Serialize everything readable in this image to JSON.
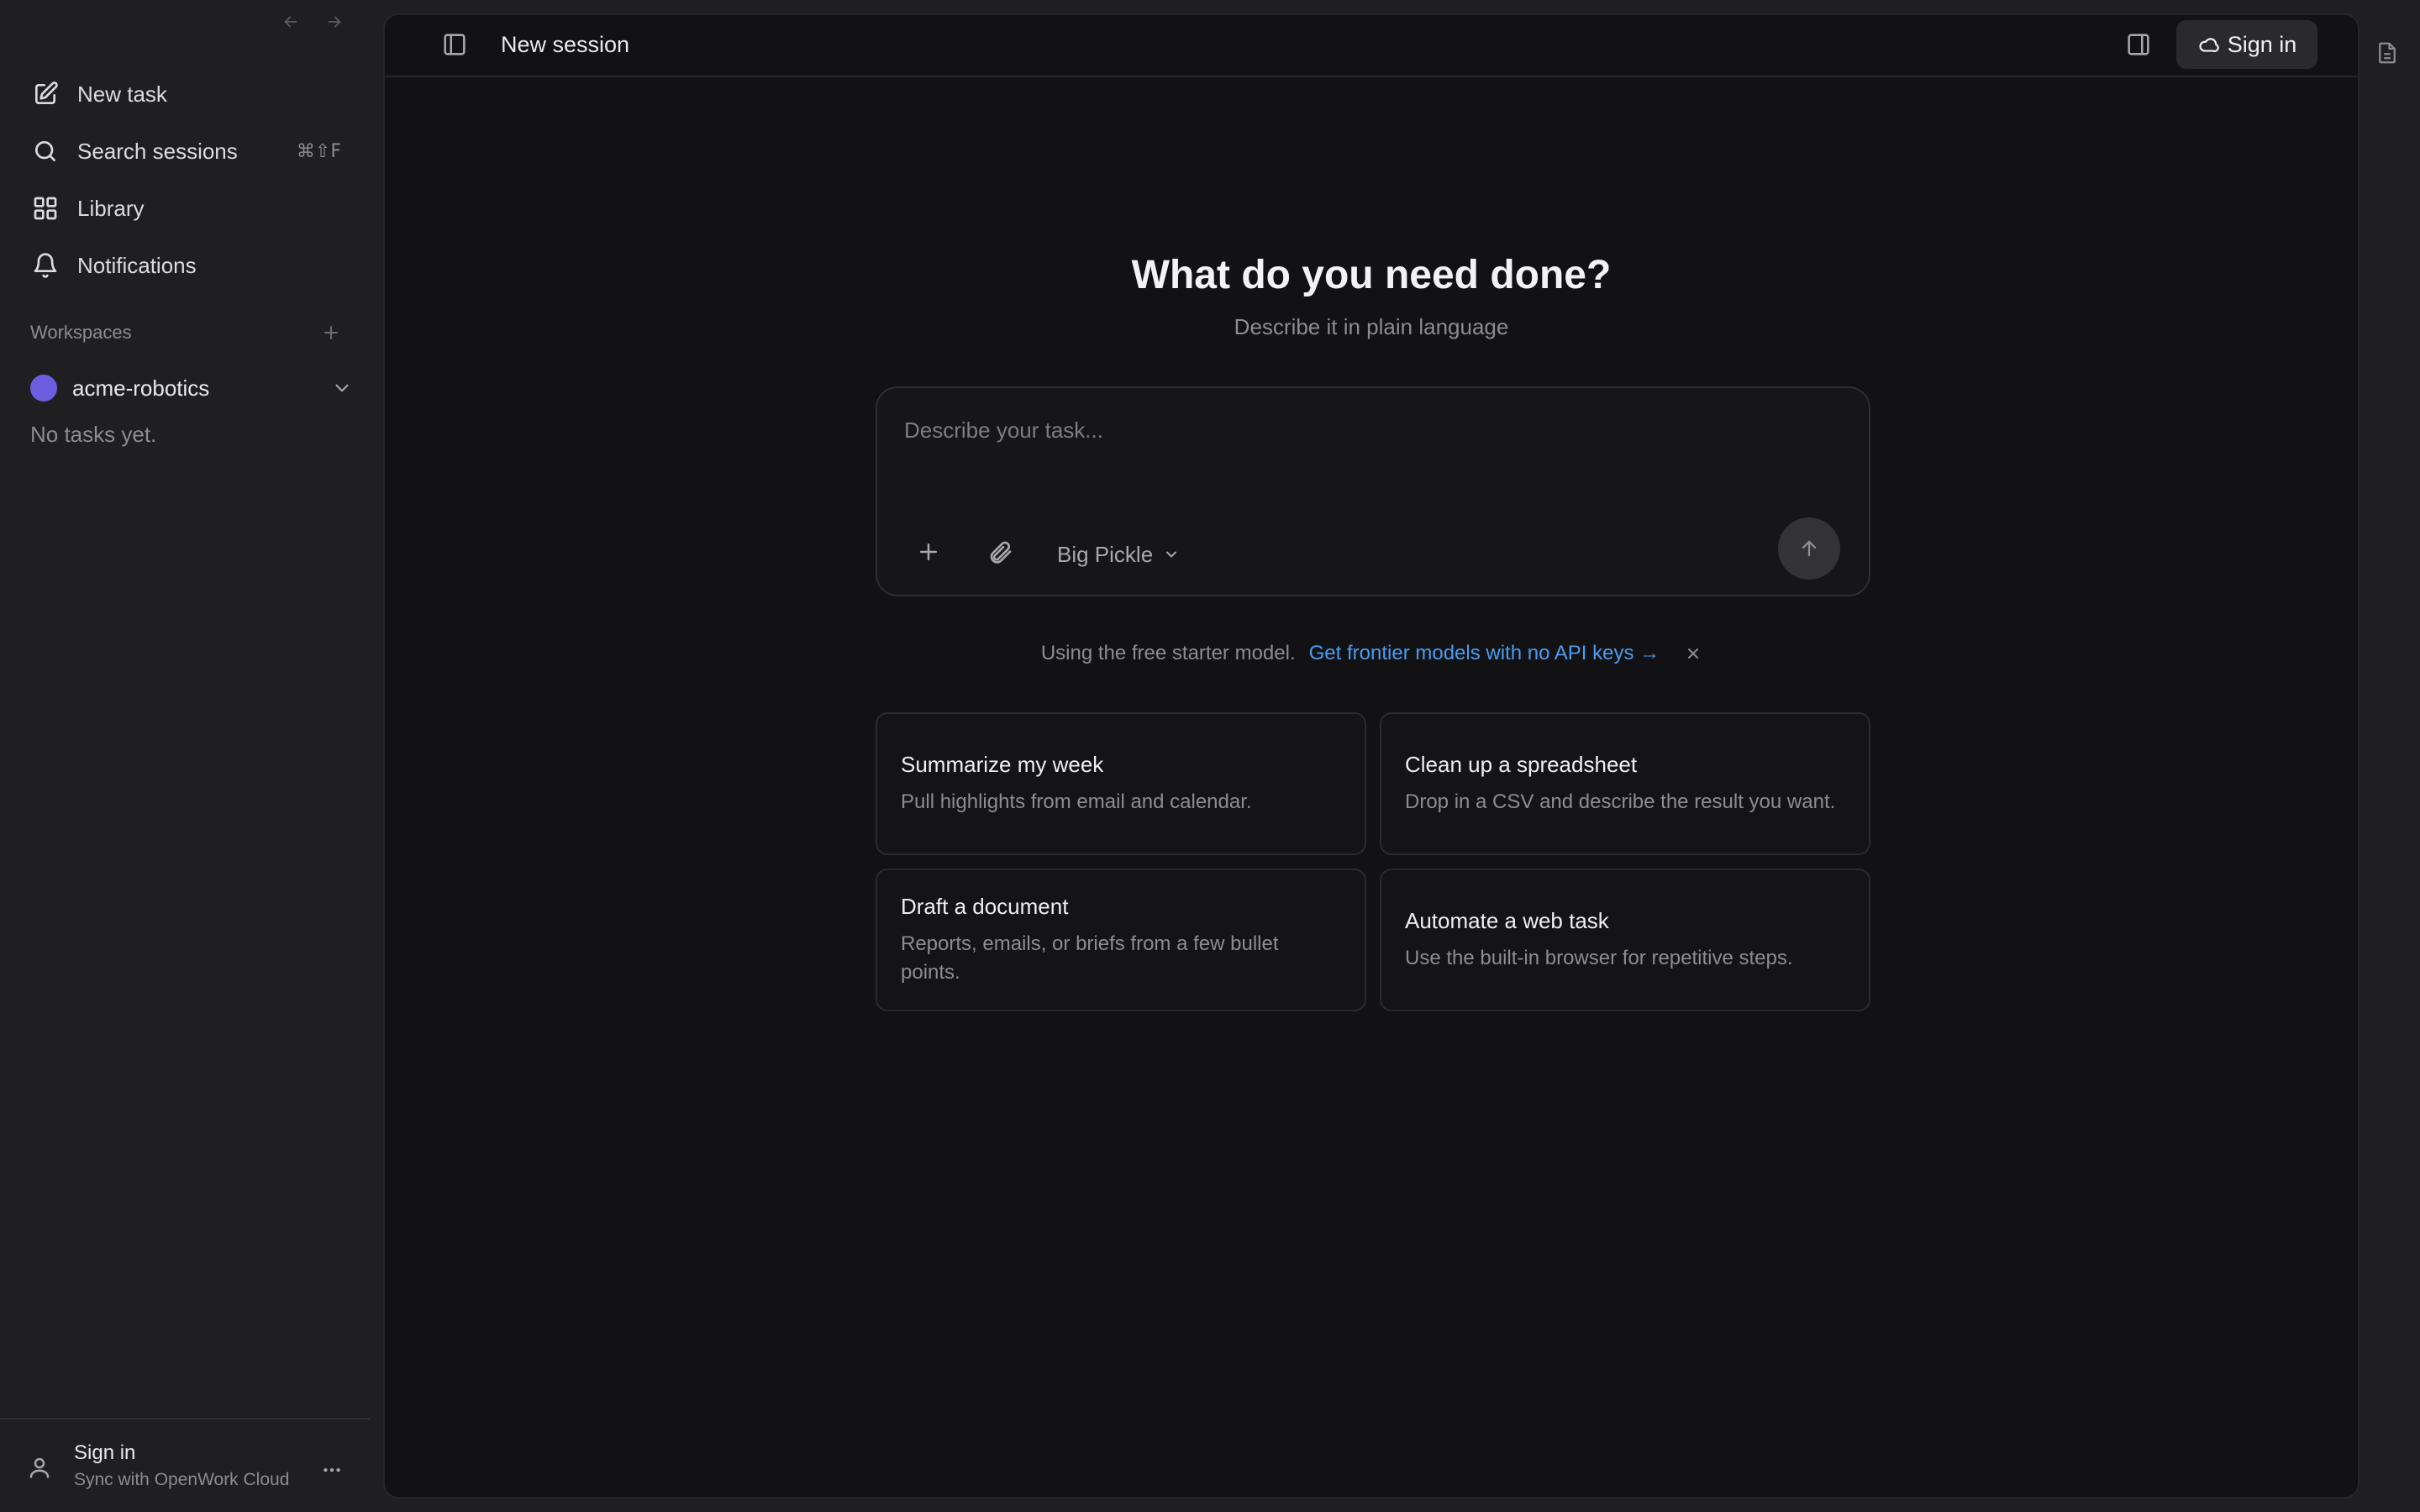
{
  "sidebar": {
    "nav": [
      {
        "label": "New task",
        "icon": "pencil-square-icon"
      },
      {
        "label": "Search sessions",
        "icon": "search-icon",
        "shortcut": "⌘⇧F"
      },
      {
        "label": "Library",
        "icon": "grid-icon"
      },
      {
        "label": "Notifications",
        "icon": "bell-icon"
      }
    ],
    "workspaces_title": "Workspaces",
    "workspace": {
      "name": "acme-robotics",
      "color": "#6d5ee0"
    },
    "empty_text": "No tasks yet.",
    "footer": {
      "title": "Sign in",
      "subtitle": "Sync with OpenWork Cloud"
    }
  },
  "topbar": {
    "title": "New session",
    "signin_label": "Sign in"
  },
  "hero": {
    "title": "What do you need done?",
    "subtitle": "Describe it in plain language"
  },
  "composer": {
    "placeholder": "Describe your task...",
    "model": "Big Pickle"
  },
  "notice": {
    "text": "Using the free starter model.",
    "link": "Get frontier models with no API keys →"
  },
  "suggestions": [
    {
      "title": "Summarize my week",
      "desc": "Pull highlights from email and calendar."
    },
    {
      "title": "Clean up a spreadsheet",
      "desc": "Drop in a CSV and describe the result you want."
    },
    {
      "title": "Draft a document",
      "desc": "Reports, emails, or briefs from a few bullet points."
    },
    {
      "title": "Automate a web task",
      "desc": "Use the built-in browser for repetitive steps."
    }
  ],
  "colors": {
    "accent_link": "#4b9cf0",
    "workspace_dot": "#6d5ee0",
    "sidebar_bg": "#1f1f21",
    "main_bg": "#121214"
  }
}
